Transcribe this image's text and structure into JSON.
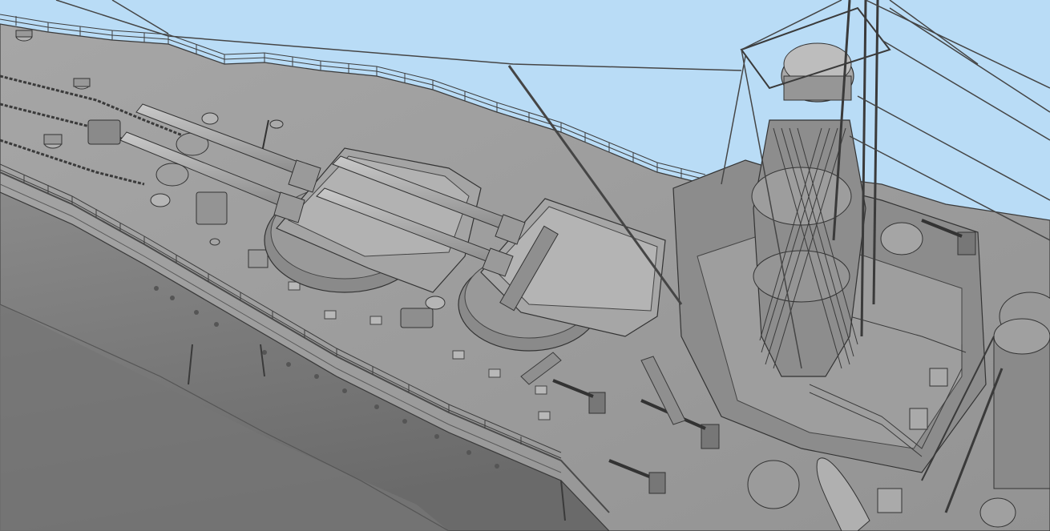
{
  "viewport": {
    "kind": "3d-model-render",
    "background_color": "#b9dcf6"
  },
  "model": {
    "subject": "battleship-3d-model",
    "colors": {
      "hull": "#7e7e7e",
      "hull_dark": "#6a6a6a",
      "deck": "#9b9b9b",
      "deck_light": "#a9a9a9",
      "edge": "#3a3a3a",
      "rigging": "#4a4a4a"
    }
  }
}
